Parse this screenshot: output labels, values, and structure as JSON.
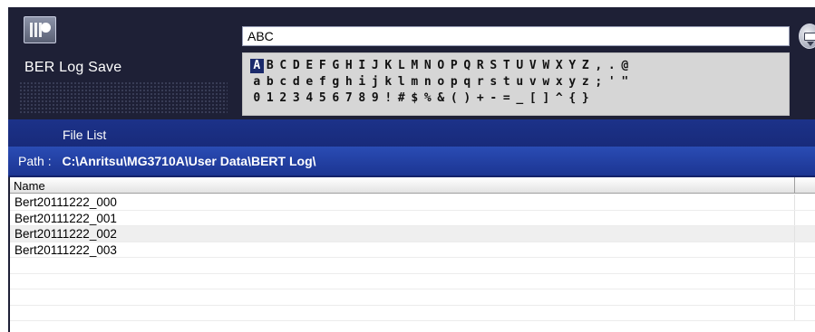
{
  "header": {
    "title": "BER Log Save",
    "input_value": "ABC",
    "char_rows": [
      [
        "A",
        "B",
        "C",
        "D",
        "E",
        "F",
        "G",
        "H",
        "I",
        "J",
        "K",
        "L",
        "M",
        "N",
        "O",
        "P",
        "Q",
        "R",
        "S",
        "T",
        "U",
        "V",
        "W",
        "X",
        "Y",
        "Z",
        ",",
        ".",
        "@"
      ],
      [
        "a",
        "b",
        "c",
        "d",
        "e",
        "f",
        "g",
        "h",
        "i",
        "j",
        "k",
        "l",
        "m",
        "n",
        "o",
        "p",
        "q",
        "r",
        "s",
        "t",
        "u",
        "v",
        "w",
        "x",
        "y",
        "z",
        ";",
        "'",
        "\""
      ],
      [
        "0",
        "1",
        "2",
        "3",
        "4",
        "5",
        "6",
        "7",
        "8",
        "9",
        "!",
        "#",
        "$",
        "%",
        "&",
        "(",
        ")",
        "+",
        "-",
        "=",
        "_",
        "[",
        "]",
        "^",
        "{",
        "}"
      ]
    ],
    "selected_char": "A"
  },
  "file_list": {
    "title": "File List",
    "path_label": "Path :",
    "path_value": "C:\\Anritsu\\MG3710A\\User Data\\BERT Log\\",
    "column_name": "Name",
    "items": [
      "Bert20111222_000",
      "Bert20111222_001",
      "Bert20111222_002",
      "Bert20111222_003"
    ]
  },
  "colors": {
    "panel_dark": "#1e2036",
    "band_blue": "#1c3289",
    "path_blue": "#2a4cb4",
    "selected_key": "#1b2a6b"
  }
}
